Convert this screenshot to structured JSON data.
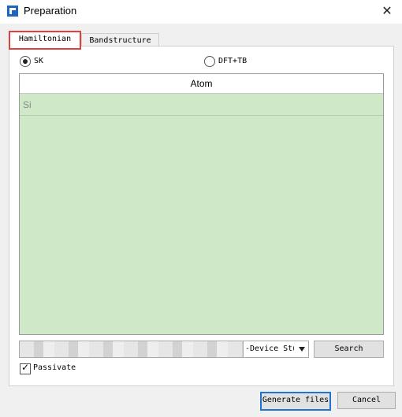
{
  "window": {
    "title": "Preparation"
  },
  "tabs": [
    {
      "label": "Hamiltonian",
      "active": true
    },
    {
      "label": "Bandstructure",
      "active": false
    }
  ],
  "methods": [
    {
      "label": "SK",
      "selected": true
    },
    {
      "label": "DFT+TB",
      "selected": false
    }
  ],
  "atom_table": {
    "header": "Atom",
    "rows": [
      "Si"
    ]
  },
  "structure_combo": {
    "value": "-Device Stu"
  },
  "search_label": "Search",
  "passivate": {
    "label": "Passivate",
    "checked": true
  },
  "footer": {
    "generate_label": "Generate files",
    "cancel_label": "Cancel"
  },
  "colors": {
    "table_fill": "#cfe8c8",
    "active_tab_outline": "#e0403e",
    "default_button_border": "#1f74d0",
    "icon": "#1a66c0"
  },
  "icons": {
    "close": "close-icon",
    "app": "app-icon",
    "dropdown": "chevron-down-icon",
    "check": "checkmark-icon"
  }
}
